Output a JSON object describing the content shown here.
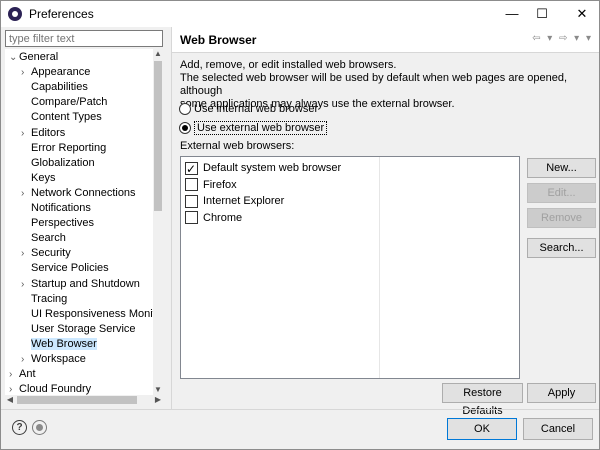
{
  "window": {
    "title": "Preferences",
    "minimize_glyph": "—",
    "maximize_glyph": "☐",
    "close_glyph": "✕"
  },
  "sidebar": {
    "filter_placeholder": "type filter text",
    "items": [
      {
        "label": "General",
        "expand": "v"
      },
      {
        "label": "Appearance",
        "expand": ">"
      },
      {
        "label": "Capabilities",
        "expand": ""
      },
      {
        "label": "Compare/Patch",
        "expand": ""
      },
      {
        "label": "Content Types",
        "expand": ""
      },
      {
        "label": "Editors",
        "expand": ">"
      },
      {
        "label": "Error Reporting",
        "expand": ""
      },
      {
        "label": "Globalization",
        "expand": ""
      },
      {
        "label": "Keys",
        "expand": ""
      },
      {
        "label": "Network Connections",
        "expand": ">"
      },
      {
        "label": "Notifications",
        "expand": ""
      },
      {
        "label": "Perspectives",
        "expand": ""
      },
      {
        "label": "Search",
        "expand": ""
      },
      {
        "label": "Security",
        "expand": ">"
      },
      {
        "label": "Service Policies",
        "expand": ""
      },
      {
        "label": "Startup and Shutdown",
        "expand": ">"
      },
      {
        "label": "Tracing",
        "expand": ""
      },
      {
        "label": "UI Responsiveness Monito",
        "expand": ""
      },
      {
        "label": "User Storage Service",
        "expand": ""
      },
      {
        "label": "Web Browser",
        "expand": "",
        "selected": true
      },
      {
        "label": "Workspace",
        "expand": ">"
      },
      {
        "label": "Ant",
        "expand": ">"
      },
      {
        "label": "Cloud Foundry",
        "expand": ">"
      }
    ]
  },
  "page": {
    "title": "Web Browser",
    "description_line1": "Add, remove, or edit installed web browsers.",
    "description_line2": "The selected web browser will be used by default when web pages are opened, although",
    "description_line3": "some applications may always use the external browser.",
    "radio_internal": "Use internal web browser",
    "radio_external": "Use external web browser",
    "list_label": "External web browsers:",
    "browsers": [
      {
        "label": "Default system web browser",
        "checked": true
      },
      {
        "label": "Firefox",
        "checked": false
      },
      {
        "label": "Internet Explorer",
        "checked": false
      },
      {
        "label": "Chrome",
        "checked": false
      }
    ],
    "buttons": {
      "new": "New...",
      "edit": "Edit...",
      "remove": "Remove",
      "search": "Search..."
    },
    "restore_defaults": "Restore Defaults",
    "apply": "Apply"
  },
  "footer": {
    "ok": "OK",
    "cancel": "Cancel"
  },
  "icons": {
    "help": "?",
    "back_forward": "⇦ ▾ ⇨ ▾ ▾"
  }
}
